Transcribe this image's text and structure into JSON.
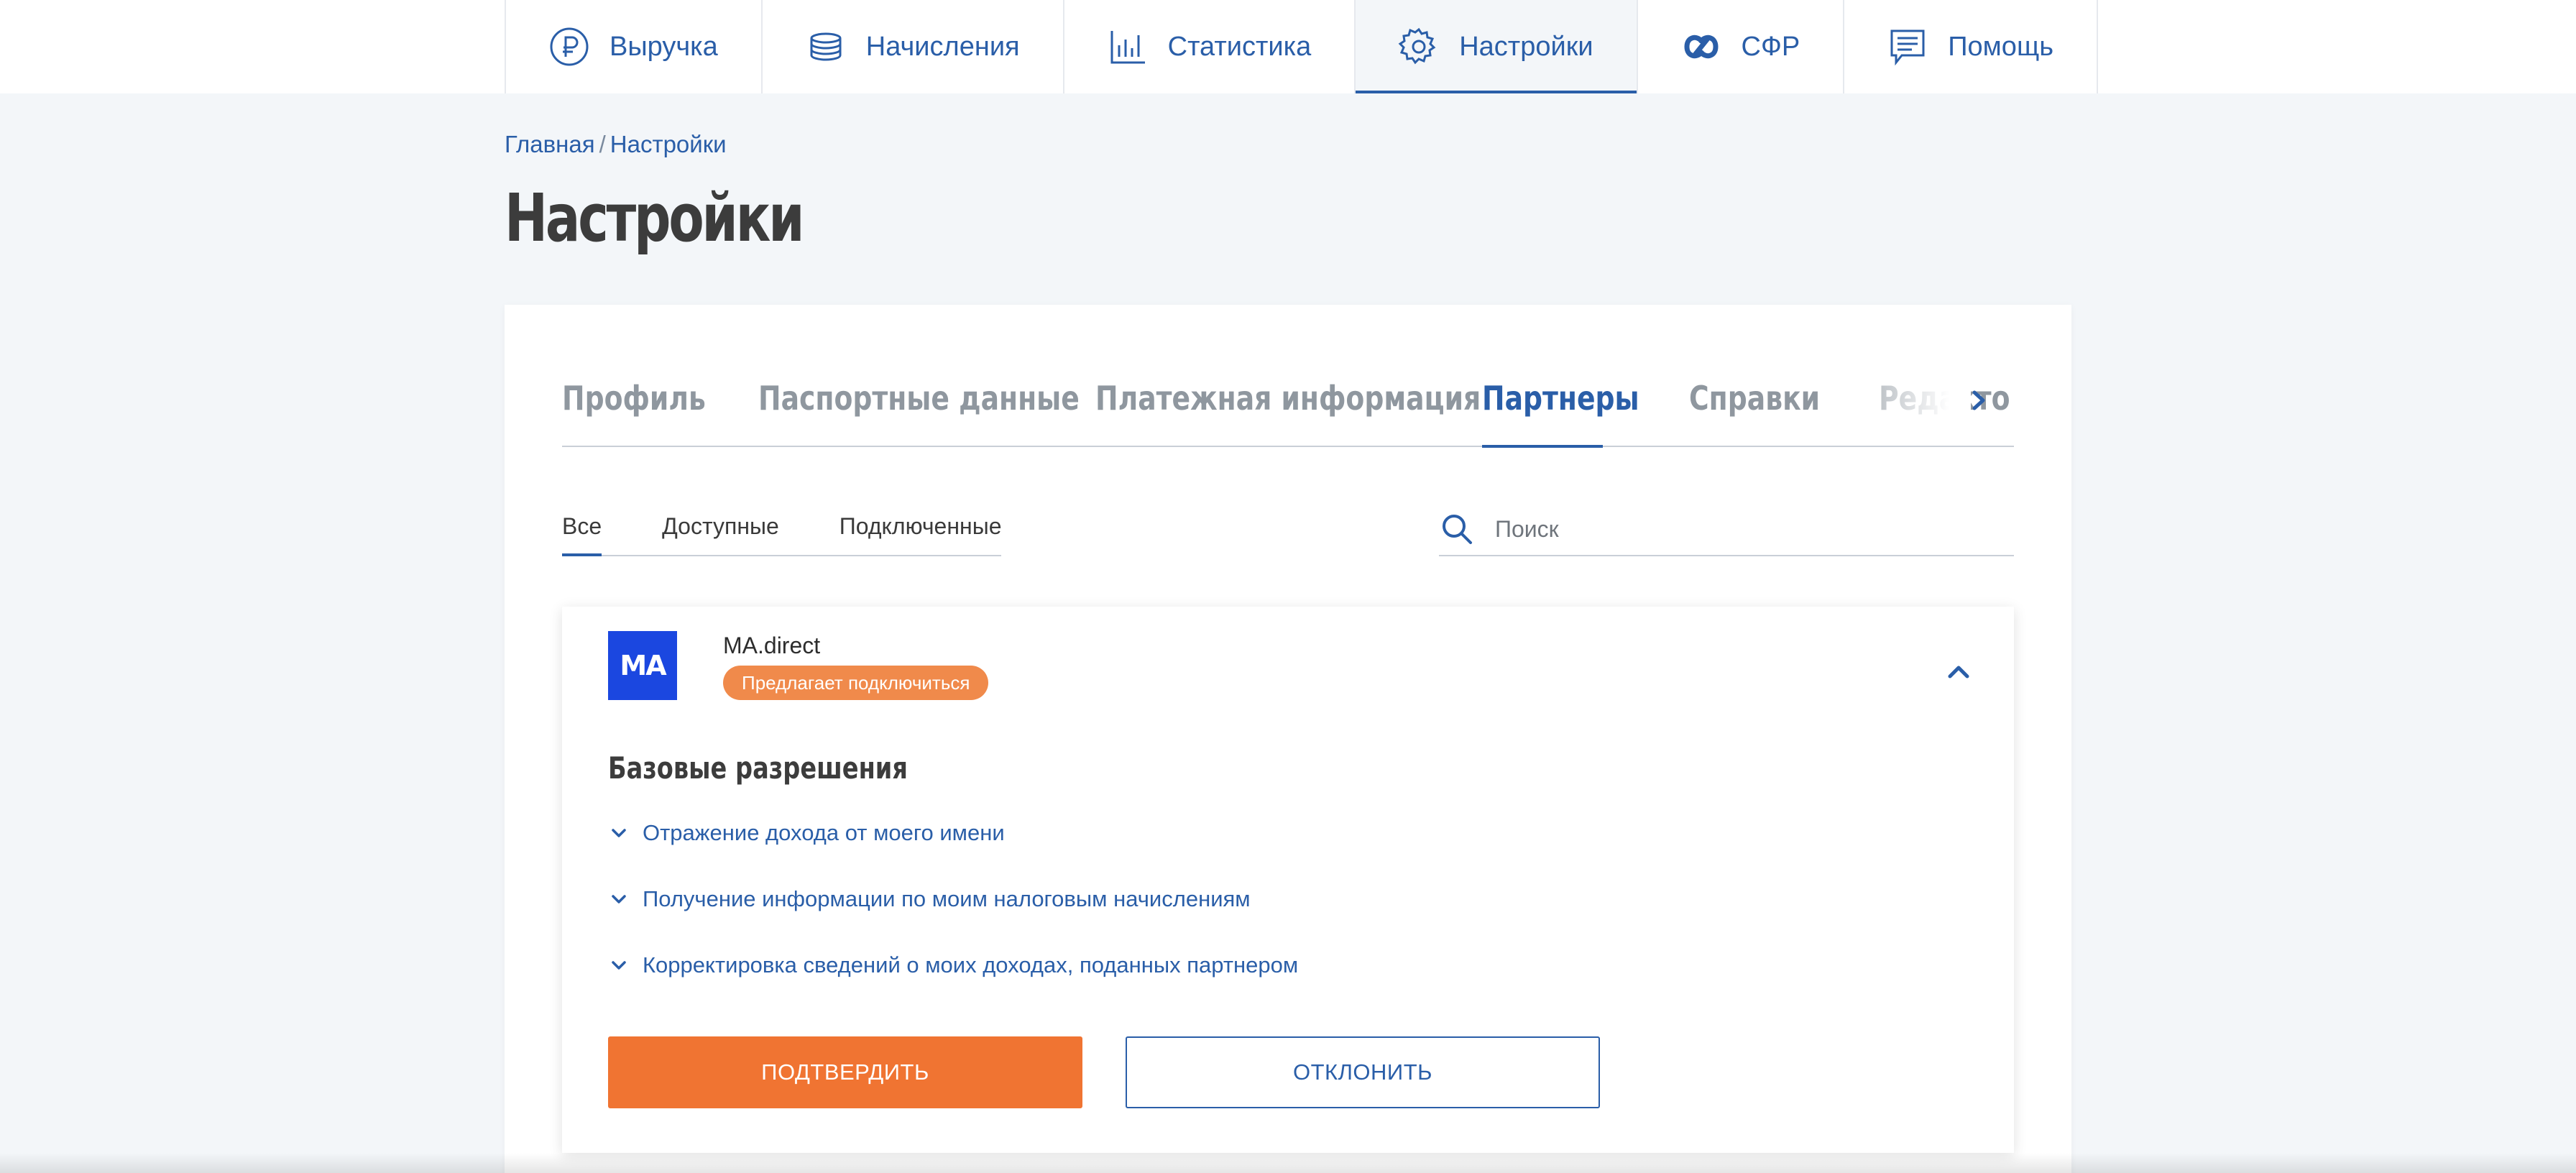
{
  "topnav": {
    "items": [
      {
        "label": "Выручка",
        "icon": "ruble-icon"
      },
      {
        "label": "Начисления",
        "icon": "coins-icon"
      },
      {
        "label": "Статистика",
        "icon": "bar-chart-icon"
      },
      {
        "label": "Настройки",
        "icon": "gear-icon",
        "active": true
      },
      {
        "label": "СФР",
        "icon": "sfr-logo-icon"
      },
      {
        "label": "Помощь",
        "icon": "message-icon"
      }
    ]
  },
  "breadcrumb": {
    "home": "Главная",
    "separator": "/",
    "current": "Настройки"
  },
  "page": {
    "title": "Настройки"
  },
  "tabs": {
    "items": [
      "Профиль",
      "Паспортные данные",
      "Платежная информация",
      "Партнеры",
      "Справки",
      "Редакто"
    ],
    "active": "Партнеры"
  },
  "filters": {
    "items": [
      "Все",
      "Доступные",
      "Подключенные"
    ],
    "active": "Все"
  },
  "search": {
    "placeholder": "Поиск",
    "value": ""
  },
  "partner": {
    "logo_text": "MA",
    "name": "MA.direct",
    "badge": "Предлагает подключиться",
    "permissions_title": "Базовые разрешения",
    "permissions": [
      "Отражение дохода от моего имени",
      "Получение информации по моим налоговым начислениям",
      "Корректировка сведений о моих доходах, поданных партнером"
    ],
    "confirm_label": "Подтвердить",
    "reject_label": "Отклонить"
  },
  "colors": {
    "accent": "#2a5ea8",
    "primary_button": "#f07432",
    "badge": "#f08a4b",
    "logo_bg": "#1b47e0",
    "background": "#f3f6f9"
  }
}
